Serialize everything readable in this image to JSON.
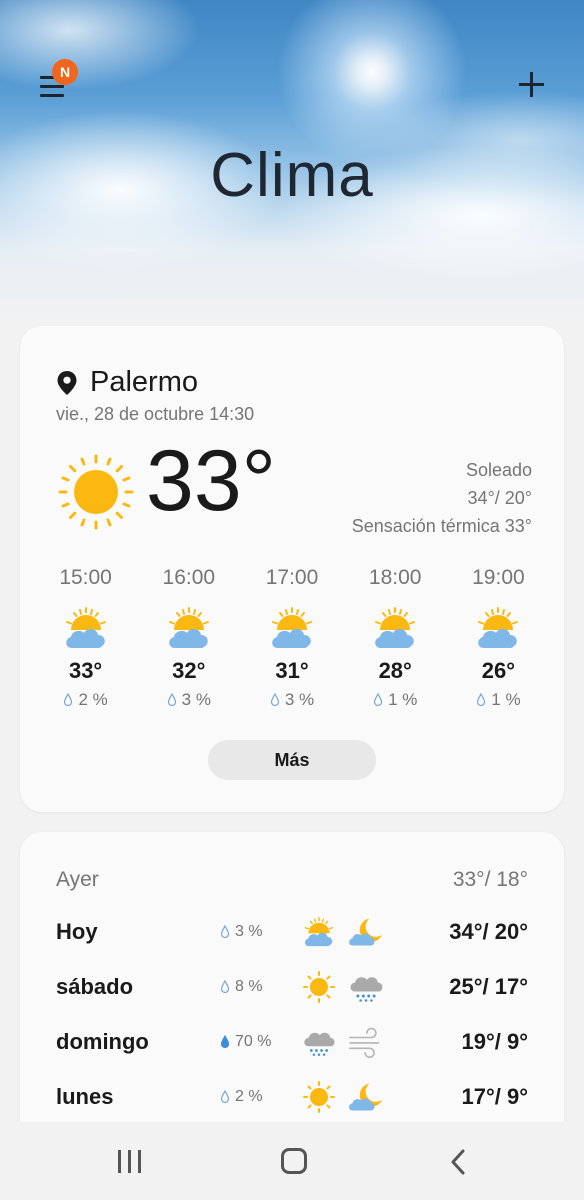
{
  "header": {
    "title": "Clima",
    "notification_badge": "N",
    "menu_icon": "hamburger-menu-icon",
    "add_icon": "plus-icon"
  },
  "current": {
    "location": "Palermo",
    "datetime": "vie., 28 de octubre 14:30",
    "temperature": "33°",
    "condition": "Soleado",
    "high_low": "34°/ 20°",
    "feels_like": "Sensación térmica 33°",
    "icon": "sun-icon"
  },
  "hourly": [
    {
      "time": "15:00",
      "temp": "33°",
      "rain": "2 %",
      "icon": "partly-cloudy-icon"
    },
    {
      "time": "16:00",
      "temp": "32°",
      "rain": "3 %",
      "icon": "partly-cloudy-icon"
    },
    {
      "time": "17:00",
      "temp": "31°",
      "rain": "3 %",
      "icon": "partly-cloudy-icon"
    },
    {
      "time": "18:00",
      "temp": "28°",
      "rain": "1 %",
      "icon": "partly-cloudy-icon"
    },
    {
      "time": "19:00",
      "temp": "26°",
      "rain": "1 %",
      "icon": "partly-cloudy-icon"
    }
  ],
  "more_label": "Más",
  "forecast": [
    {
      "day": "Ayer",
      "rain": "",
      "temps": "33°/ 18°",
      "icon_day": "",
      "icon_night": ""
    },
    {
      "day": "Hoy",
      "rain": "3 %",
      "temps": "34°/ 20°",
      "icon_day": "partly-cloudy-icon",
      "icon_night": "moon-cloud-icon"
    },
    {
      "day": "sábado",
      "rain": "8 %",
      "temps": "25°/ 17°",
      "icon_day": "sun-icon",
      "icon_night": "rain-cloud-icon"
    },
    {
      "day": "domingo",
      "rain": "70 %",
      "temps": "19°/ 9°",
      "icon_day": "rain-cloud-icon",
      "icon_night": "wind-icon"
    },
    {
      "day": "lunes",
      "rain": "2 %",
      "temps": "17°/ 9°",
      "icon_day": "sun-icon",
      "icon_night": "moon-cloud-icon"
    }
  ],
  "colors": {
    "sun": "#fbb811",
    "cloud": "#7fb7e8",
    "badge": "#f0661f",
    "rain_drop_active": "#3d8fd8"
  }
}
